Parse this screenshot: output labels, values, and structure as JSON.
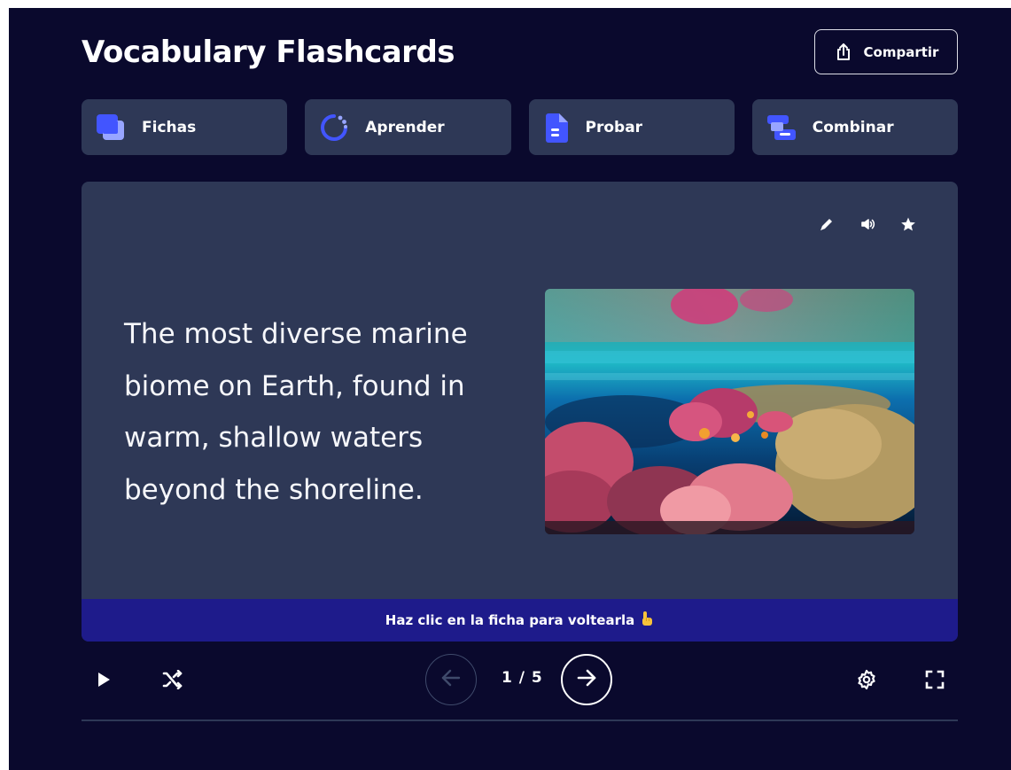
{
  "header": {
    "title": "Vocabulary Flashcards",
    "share_label": "Compartir"
  },
  "modes": [
    {
      "label": "Fichas",
      "icon": "flashcards-icon",
      "color": "#4255ff"
    },
    {
      "label": "Aprender",
      "icon": "learn-icon",
      "color": "#4255ff"
    },
    {
      "label": "Probar",
      "icon": "test-icon",
      "color": "#4255ff"
    },
    {
      "label": "Combinar",
      "icon": "match-icon",
      "color": "#4255ff"
    }
  ],
  "card": {
    "definition": "The most diverse marine biome on Earth, found in warm, shallow waters beyond the shoreline.",
    "image_subject": "coral reef underwater photo",
    "tools": [
      "edit-icon",
      "audio-icon",
      "star-icon"
    ],
    "flip_hint": "Haz clic en la ficha para voltearla",
    "flip_hint_icon": "pointing-hand-icon"
  },
  "navigation": {
    "counter": "1 / 5",
    "current": 1,
    "total": 5
  },
  "colors": {
    "background": "#0a092d",
    "panel": "#2e3856",
    "accent": "#4255ff",
    "hint_bar": "#1e1b8b"
  }
}
